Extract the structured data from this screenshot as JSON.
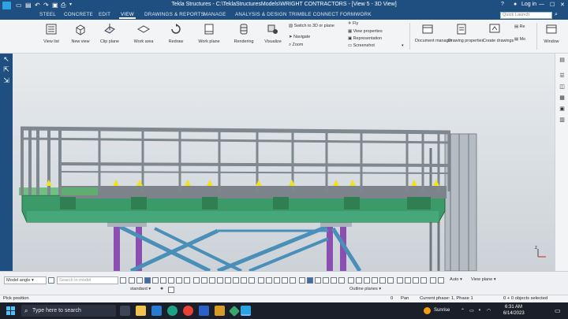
{
  "titlebar": {
    "title": "Tekla Structures - C:\\TeklaStructuresModels\\WRIGHT CONTRACTORS - [View 5 - 3D View]",
    "help": "?",
    "login": "Log in",
    "min": "—",
    "max": "☐",
    "close": "✕"
  },
  "menu": {
    "tabs": [
      "STEEL",
      "CONCRETE",
      "EDIT",
      "VIEW",
      "DRAWINGS & REPORTS",
      "MANAGE",
      "ANALYSIS & DESIGN",
      "TRIMBLE CONNECT",
      "FORMWORK"
    ],
    "active_tab": "VIEW",
    "search_placeholder": "Quick Launch"
  },
  "ribbon": {
    "buttons": [
      "View list",
      "New view",
      "Clip plane",
      "Work area",
      "Redraw",
      "Work plane",
      "Rendering",
      "Visualize"
    ],
    "small_col1": [
      "Switch to 3D or plane",
      "Navigate",
      "Zoom"
    ],
    "small_col2": [
      "Fly",
      "View properties",
      "Representation",
      "Screenshot"
    ],
    "buttons_right": [
      "Document manager",
      "Drawing properties",
      "Create drawings"
    ],
    "re_label": "Re",
    "mo_label": "Mo",
    "window_label": "Window"
  },
  "bottom": {
    "snap_mode": "Model angle",
    "search_placeholder": "Search in model",
    "standard": "standard",
    "auto": "Auto",
    "view_plane": "View plane",
    "outline_planes": "Outline planes"
  },
  "status": {
    "left": "Pick position",
    "zero": "0",
    "pan": "Pan",
    "phase": "Current phase: 1, Phase 1",
    "selected": "0 + 0 objects selected"
  },
  "taskbar": {
    "search": "Type here to search",
    "weather": "Sunrise",
    "time": "6:31 AM",
    "date": "6/14/2023"
  },
  "colors": {
    "title_blue": "#1f4f80",
    "beam_green": "#3c9a68",
    "bracing_purple": "#8a4fb0",
    "beam_gray": "#8f969e"
  }
}
